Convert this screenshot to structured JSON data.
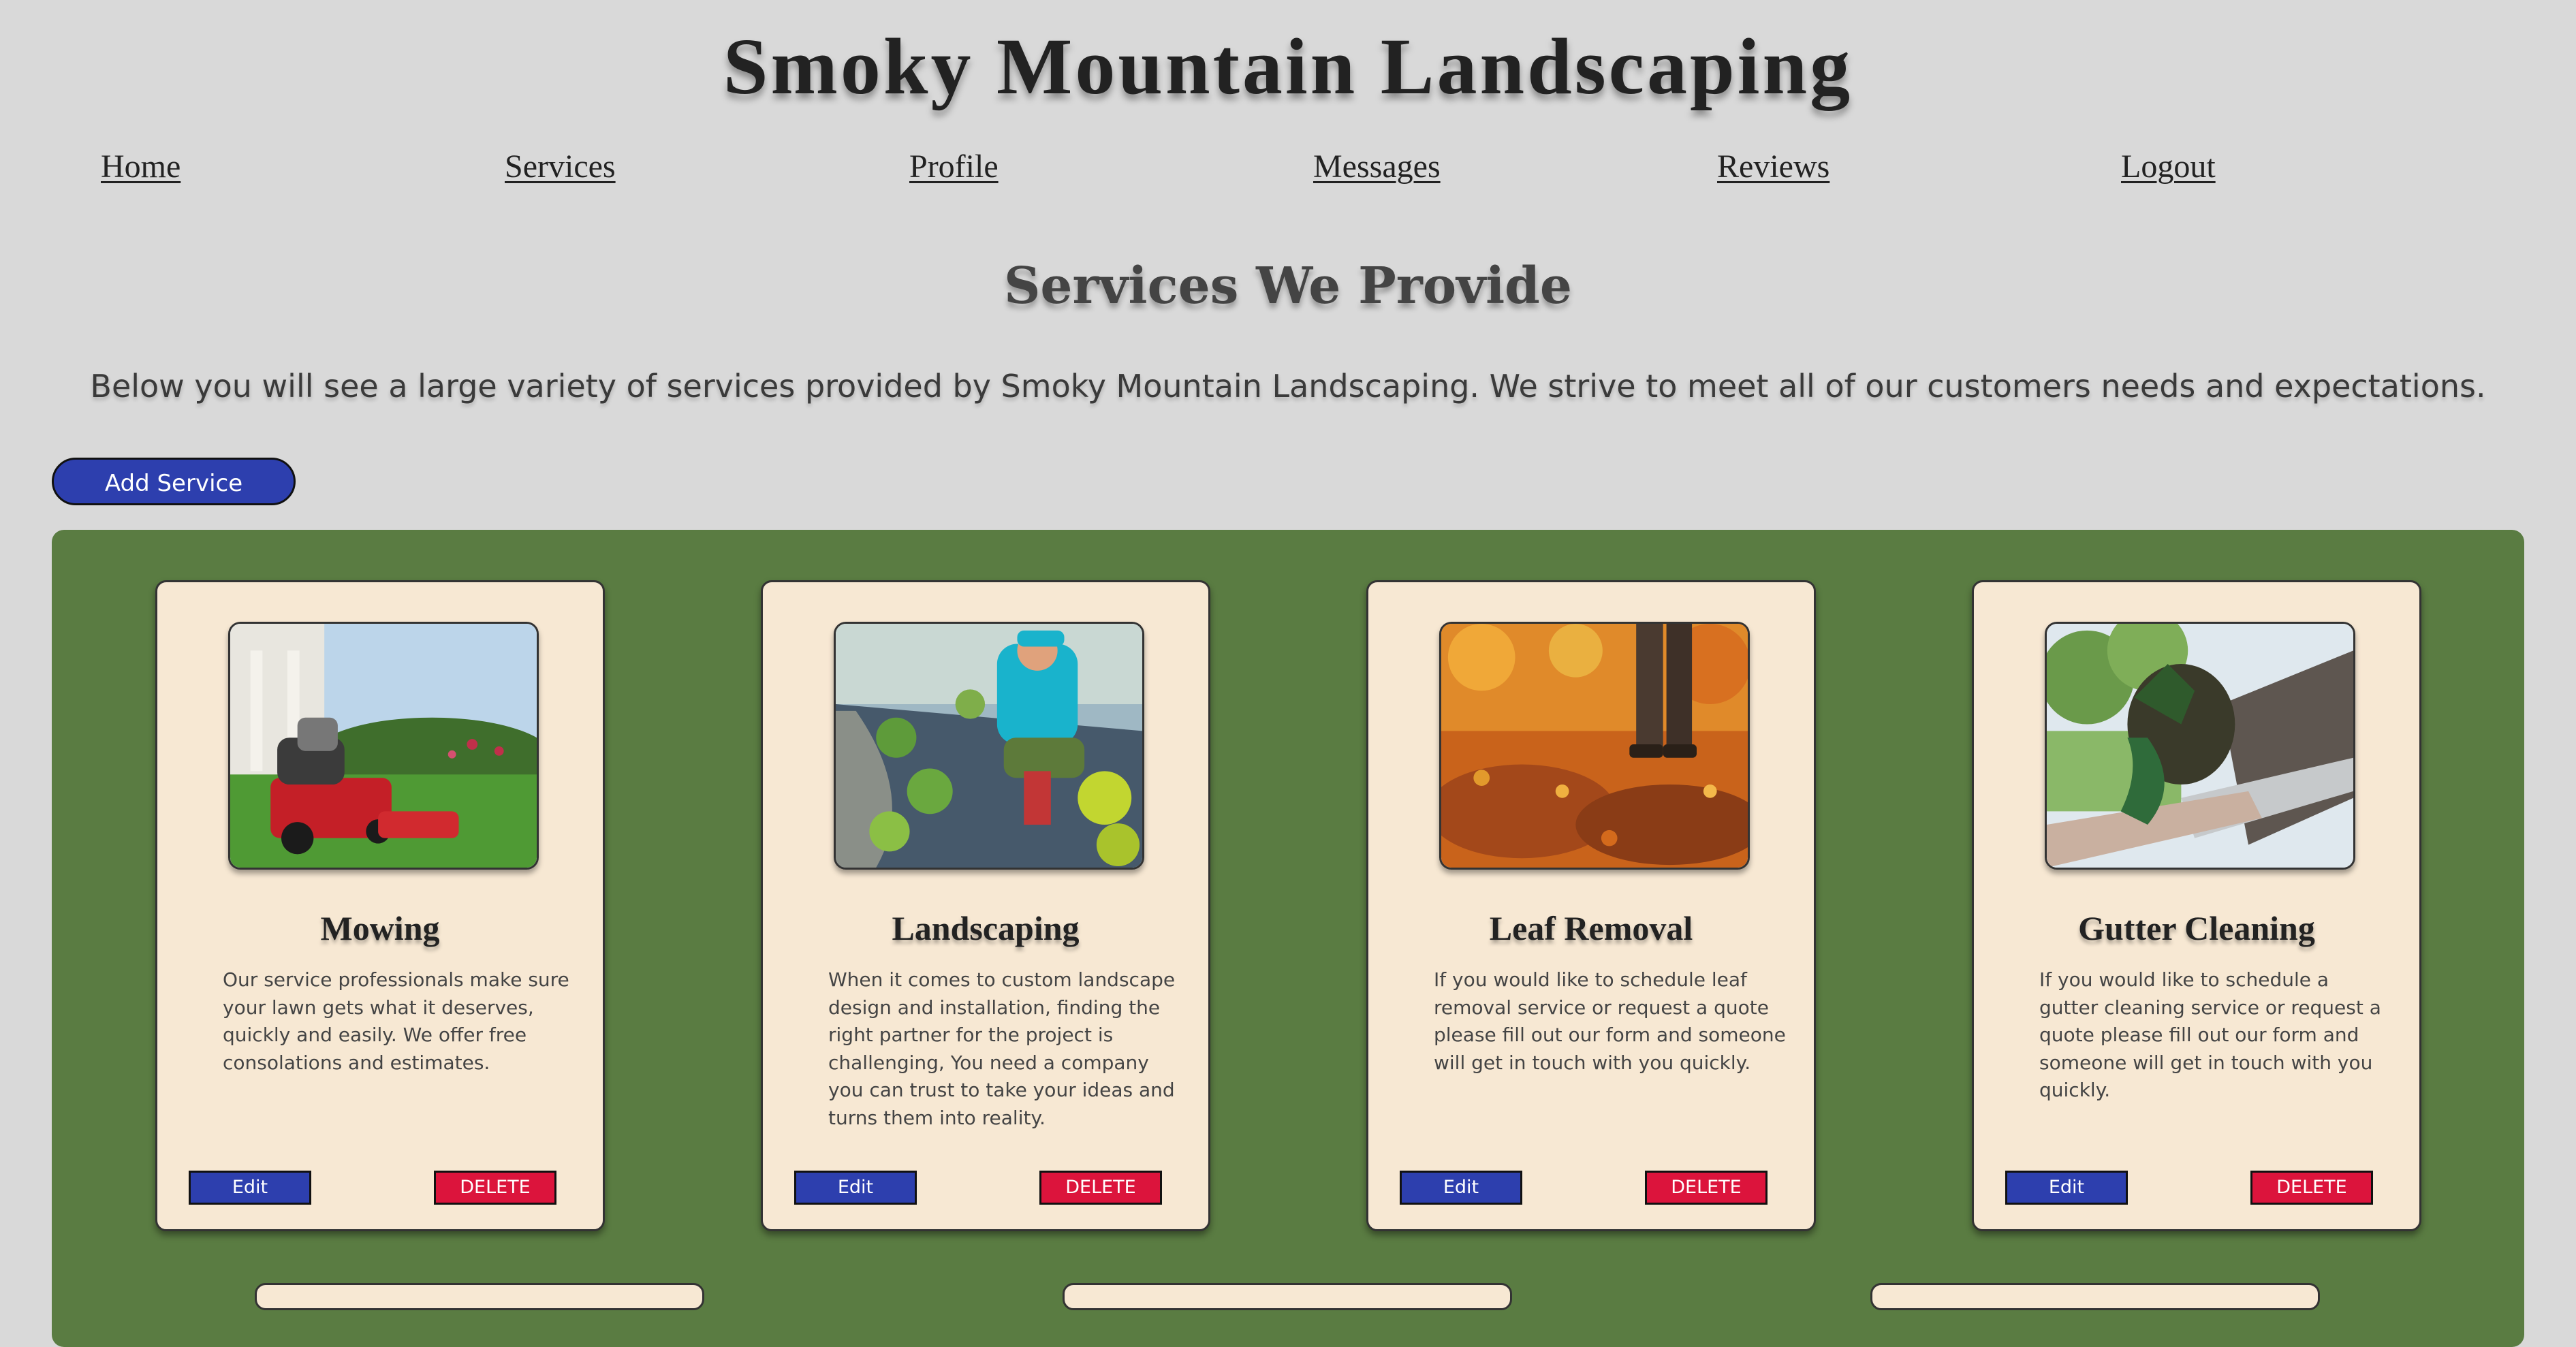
{
  "site": {
    "title": "Smoky Mountain Landscaping"
  },
  "nav": {
    "items": [
      {
        "label": "Home"
      },
      {
        "label": "Services"
      },
      {
        "label": "Profile"
      },
      {
        "label": "Messages"
      },
      {
        "label": "Reviews"
      },
      {
        "label": "Logout"
      }
    ]
  },
  "page": {
    "heading": "Services We Provide",
    "intro": "Below you will see a large variety of services provided by Smoky Mountain Landscaping. We strive to meet all of our customers needs and expectations.",
    "add_button": "Add Service"
  },
  "services": [
    {
      "title": "Mowing",
      "description": "Our service professionals make sure your lawn gets what it deserves, quickly and easily. We offer free consolations and estimates.",
      "edit_label": "Edit",
      "delete_label": "DELETE"
    },
    {
      "title": "Landscaping",
      "description": "When it comes to custom landscape design and installation, finding the right partner for the project is challenging, You need a company you can trust to take your ideas and turns them into reality.",
      "edit_label": "Edit",
      "delete_label": "DELETE"
    },
    {
      "title": "Leaf Removal",
      "description": "If you would like to schedule leaf removal service or request a quote please fill out our form and someone will get in touch with you quickly.",
      "edit_label": "Edit",
      "delete_label": "DELETE"
    },
    {
      "title": "Gutter Cleaning",
      "description": "If you would like to schedule a gutter cleaning service or request a quote please fill out our form and someone will get in touch with you quickly.",
      "edit_label": "Edit",
      "delete_label": "DELETE"
    }
  ],
  "colors": {
    "page_background": "#d9d9d9",
    "panel_green": "#5a7c42",
    "card_background": "#f7e8d3",
    "edit_blue": "#2d3fae",
    "delete_red": "#dc143c"
  }
}
